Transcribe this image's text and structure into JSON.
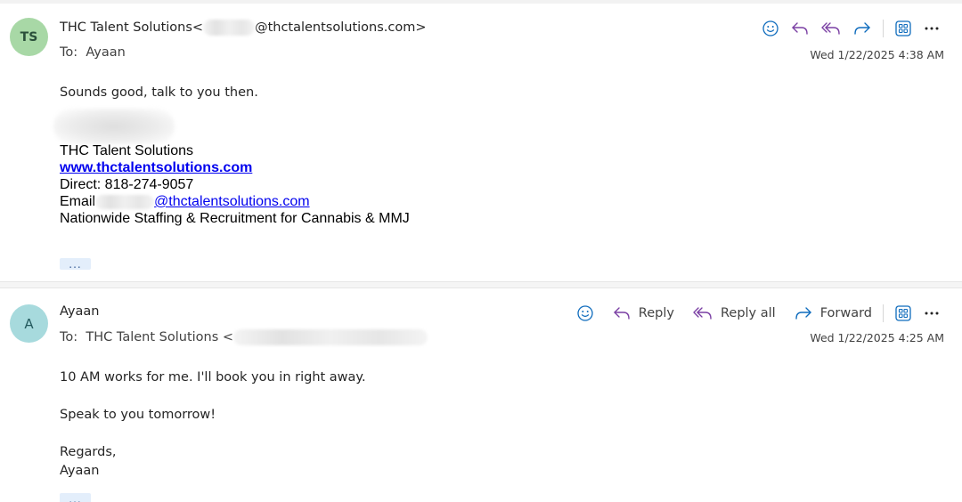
{
  "messages": [
    {
      "avatar_initials": "TS",
      "avatar_color": "#a8d8a6",
      "from_name": "THC Talent Solutions",
      "from_email_open": "<",
      "from_email_domain": "@thctalentsolutions.com>",
      "to_label": "To:",
      "to_value": "Ayaan",
      "date": "Wed 1/22/2025 4:38 AM",
      "body": "Sounds good, talk to you then.",
      "signature": {
        "company": "THC Talent Solutions",
        "website": "www.thctalentsolutions.com",
        "direct": "Direct: 818-274-9057",
        "email_prefix": "Email",
        "email_domain": "@thctalentsolutions.com",
        "tagline": "Nationwide Staffing & Recruitment for Cannabis & MMJ"
      },
      "more_label": "..."
    },
    {
      "avatar_initials": "A",
      "avatar_color": "#a7dadd",
      "from_name": "Ayaan",
      "to_label": "To:",
      "to_value": "THC Talent Solutions <",
      "date": "Wed 1/22/2025 4:25 AM",
      "body_lines": [
        "10 AM works for me. I'll book you in right away.",
        "Speak to you tomorrow!",
        "Regards,",
        "Ayaan"
      ],
      "actions": {
        "reply": "Reply",
        "reply_all": "Reply all",
        "forward": "Forward"
      },
      "more_label": "..."
    }
  ],
  "accent_color": "#0f6cbd",
  "reply_icon_color": "#7a3fa3",
  "icons": [
    "emoji-icon",
    "reply-icon",
    "reply-all-icon",
    "forward-icon",
    "apps-icon",
    "more-icon"
  ]
}
